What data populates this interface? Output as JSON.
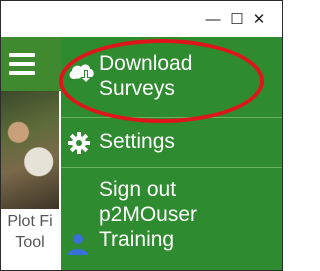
{
  "window": {
    "minimize_glyph": "—",
    "maximize_glyph": "☐",
    "close_glyph": "✕"
  },
  "background": {
    "label": "Plot Fi\nTool"
  },
  "menu": {
    "items": [
      {
        "label": "Download\nSurveys",
        "icon": "cloud-download-icon"
      },
      {
        "label": "Settings",
        "icon": "gear-icon"
      },
      {
        "label": "Sign out\np2MOuser\nTraining",
        "icon": "user-icon"
      }
    ]
  },
  "colors": {
    "header": "#3f8a2e",
    "drawer": "#2e8b2f",
    "annotation": "#e0141b"
  }
}
